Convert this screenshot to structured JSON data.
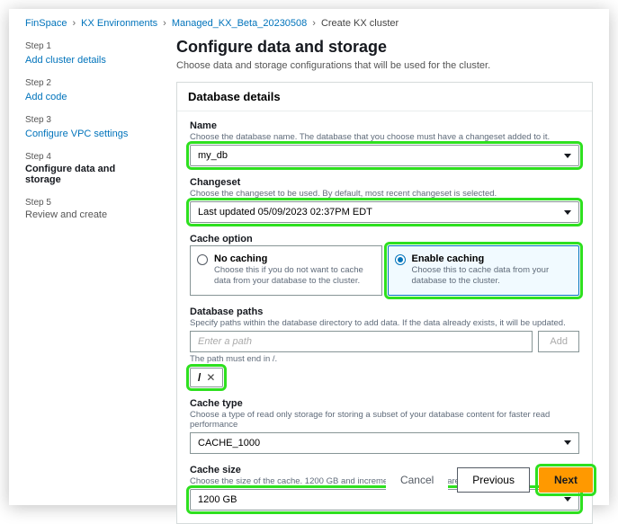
{
  "breadcrumb": {
    "items": [
      "FinSpace",
      "KX Environments",
      "Managed_KX_Beta_20230508"
    ],
    "current": "Create KX cluster"
  },
  "sidebar": {
    "steps": [
      {
        "num": "Step 1",
        "title": "Add cluster details"
      },
      {
        "num": "Step 2",
        "title": "Add code"
      },
      {
        "num": "Step 3",
        "title": "Configure VPC settings"
      },
      {
        "num": "Step 4",
        "title": "Configure data and storage",
        "active": true
      },
      {
        "num": "Step 5",
        "title": "Review and create"
      }
    ]
  },
  "page": {
    "title": "Configure data and storage",
    "subtitle": "Choose data and storage configurations that will be used for the cluster."
  },
  "panel": {
    "header": "Database details"
  },
  "dbName": {
    "label": "Name",
    "help": "Choose the database name. The database that you choose must have a changeset added to it.",
    "value": "my_db"
  },
  "changeset": {
    "label": "Changeset",
    "help": "Choose the changeset to be used. By default, most recent changeset is selected.",
    "value": "Last updated 05/09/2023 02:37PM EDT"
  },
  "cacheOption": {
    "label": "Cache option",
    "noCache": {
      "title": "No caching",
      "desc": "Choose this if you do not want to cache data from your database to the cluster."
    },
    "enable": {
      "title": "Enable caching",
      "desc": "Choose this to cache data from your database to the cluster."
    }
  },
  "dbPaths": {
    "label": "Database paths",
    "help": "Specify paths within the database directory to add data. If the data already exists, it will be updated.",
    "placeholder": "Enter a path",
    "addLabel": "Add",
    "hint": "The path must end in /.",
    "chips": [
      "/"
    ]
  },
  "cacheType": {
    "label": "Cache type",
    "help": "Choose a type of read only storage for storing a subset of your database content for faster read performance",
    "value": "CACHE_1000"
  },
  "cacheSize": {
    "label": "Cache size",
    "help": "Choose the size of the cache. 1200 GB and increments of 2400 GB are accepted.",
    "value": "1200 GB"
  },
  "footer": {
    "cancel": "Cancel",
    "previous": "Previous",
    "next": "Next"
  }
}
